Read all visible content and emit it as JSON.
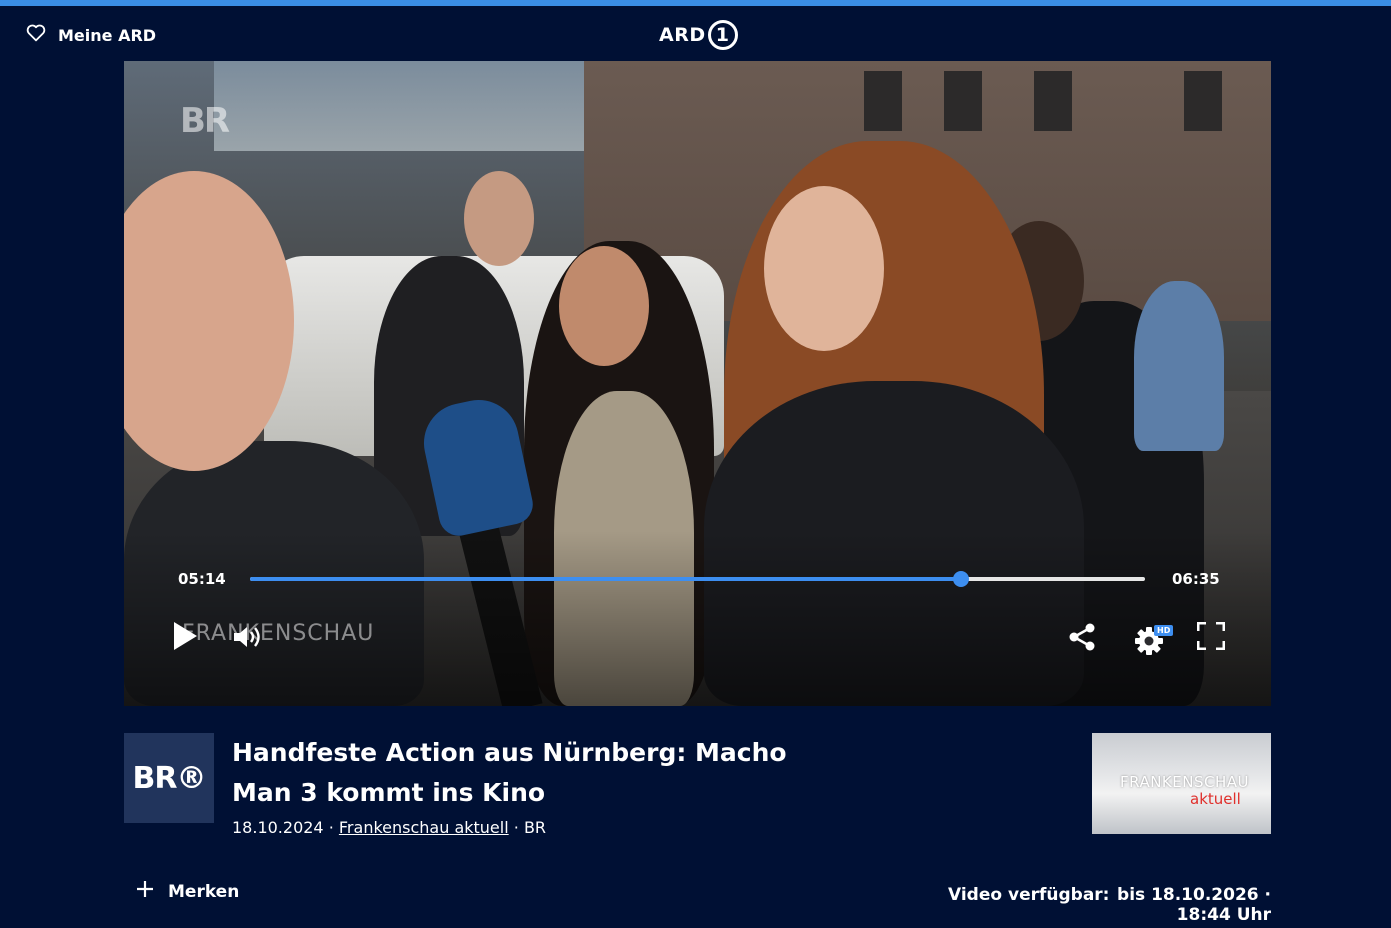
{
  "header": {
    "meine_label": "Meine ARD",
    "logo_text": "ARD",
    "logo_number": "1"
  },
  "player": {
    "current_time": "05:14",
    "duration": "06:35",
    "progress_fraction": 0.7949,
    "watermark_bug": "BR",
    "watermark_show": "FRANKENSCHAU",
    "hd_badge": "HD"
  },
  "video": {
    "channel_logo": "BR®",
    "title": "Handfeste Action aus Nürnberg: Macho Man 3 kommt ins Kino",
    "date": "18.10.2024",
    "separator": "·",
    "show_link": "Frankenschau aktuell",
    "broadcaster": "BR",
    "thumb_line1": "FRANKENSCHAU",
    "thumb_line2": "aktuell"
  },
  "actions": {
    "merken_label": "Merken",
    "available_label": "Video verfügbar:",
    "available_value": "bis 18.10.2026 · 18:44 Uhr"
  },
  "colors": {
    "background": "#001034",
    "accent": "#3d8ef0"
  },
  "icons": [
    "heart-icon",
    "play-icon",
    "volume-icon",
    "share-icon",
    "settings-icon",
    "fullscreen-icon",
    "plus-icon"
  ]
}
